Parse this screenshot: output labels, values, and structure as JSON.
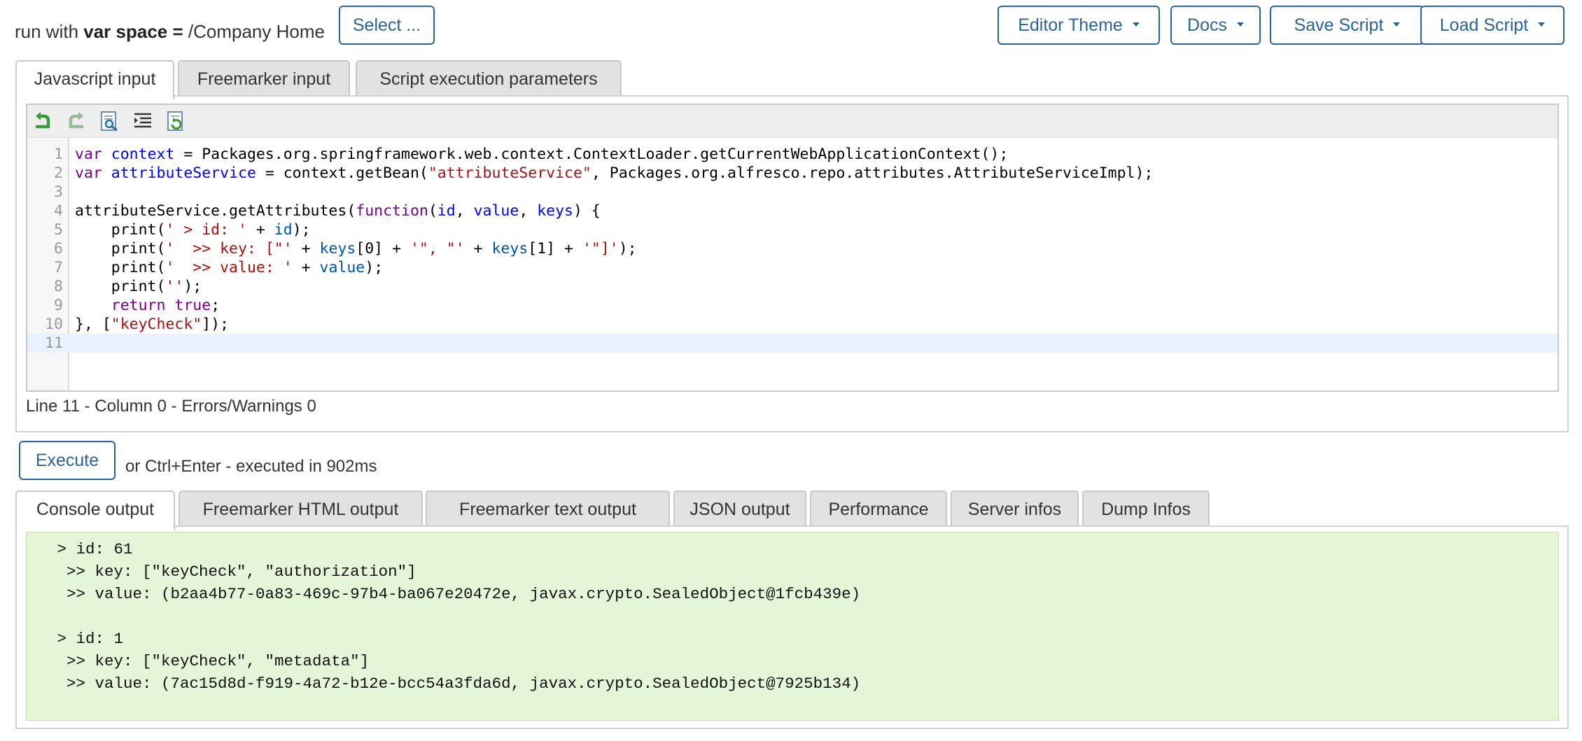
{
  "header": {
    "run_with_prefix": "run with ",
    "run_with_var": "var space",
    "run_with_eq": " = ",
    "space_path": "/Company Home",
    "select_label": "Select ...",
    "editor_theme_label": "Editor Theme",
    "docs_label": "Docs",
    "save_script_label": "Save Script",
    "load_script_label": "Load Script"
  },
  "input_tabs": [
    {
      "label": "Javascript input",
      "active": true
    },
    {
      "label": "Freemarker input",
      "active": false
    },
    {
      "label": "Script execution parameters",
      "active": false
    }
  ],
  "toolbar": {
    "icons": [
      "undo-icon",
      "redo-icon",
      "search-replace-icon",
      "format-icon",
      "reload-icon"
    ],
    "colors": {
      "undo": "#3a9a3a",
      "redo": "#9ab89a"
    }
  },
  "editor": {
    "line_numbers": [
      "1",
      "2",
      "3",
      "4",
      "5",
      "6",
      "7",
      "8",
      "9",
      "10",
      "11"
    ],
    "current_line": 11,
    "status": "Line 11 - Column 0 - Errors/Warnings 0"
  },
  "execute": {
    "label": "Execute",
    "note": "or Ctrl+Enter - executed in 902ms"
  },
  "output_tabs": [
    {
      "label": "Console output",
      "active": true
    },
    {
      "label": "Freemarker HTML output",
      "active": false
    },
    {
      "label": "Freemarker text output",
      "active": false
    },
    {
      "label": "JSON output",
      "active": false
    },
    {
      "label": "Performance",
      "active": false
    },
    {
      "label": "Server infos",
      "active": false
    },
    {
      "label": "Dump Infos",
      "active": false
    }
  ],
  "console_lines": [
    " > id: 61",
    "  >> key: [\"keyCheck\", \"authorization\"]",
    "  >> value: (b2aa4b77-0a83-469c-97b4-ba067e20472e, javax.crypto.SealedObject@1fcb439e)",
    "",
    " > id: 1",
    "  >> key: [\"keyCheck\", \"metadata\"]",
    "  >> value: (7ac15d8d-f919-4a72-b12e-bcc54a3fda6d, javax.crypto.SealedObject@7925b134)"
  ],
  "colors": {
    "accent": "#2a6496",
    "console_bg": "#e5f6d8",
    "current_line_bg": "#e8f2ff",
    "tab_inactive_bg": "#e2e2e2"
  }
}
